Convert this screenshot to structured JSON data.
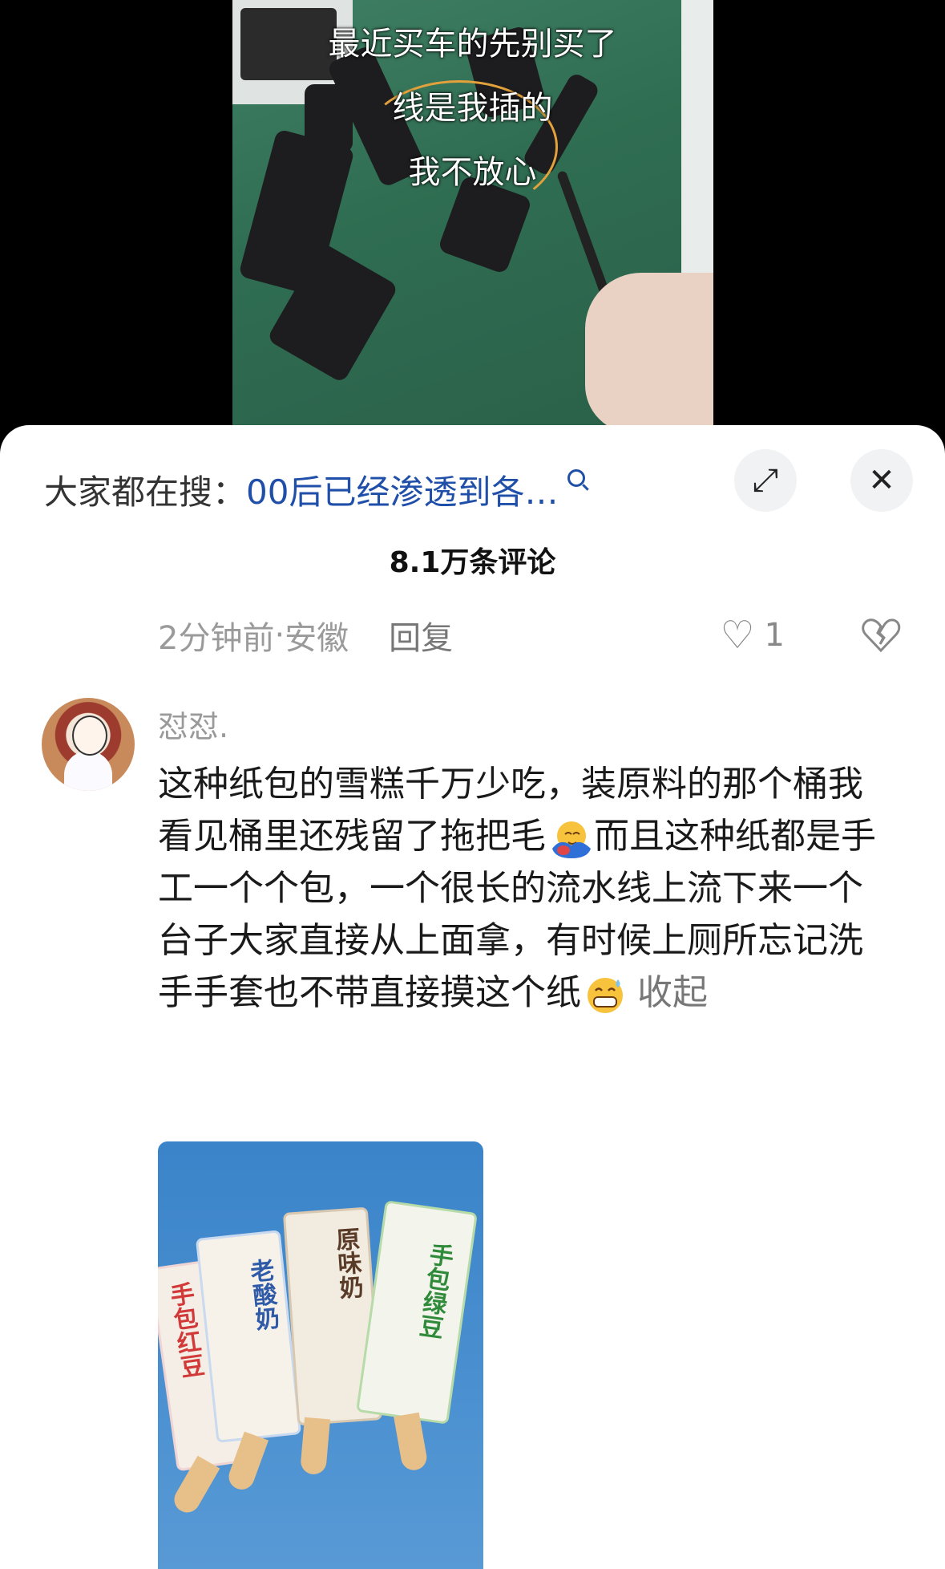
{
  "video": {
    "captions": [
      "最近买车的先别买了",
      "线是我插的",
      "我不放心"
    ]
  },
  "sheet": {
    "search_prefix": "大家都在搜：",
    "search_query": "00后已经渗透到各…",
    "expand_icon": "⤢",
    "close_icon": "✕",
    "comment_count": "8.1万条评论"
  },
  "prev_comment": {
    "time": "2分钟前",
    "separator": " · ",
    "location": "安徽",
    "reply": "回复",
    "likes": "1"
  },
  "comment": {
    "username": "怼怼.",
    "text_before_emoji1": "这种纸包的雪糕千万少吃，装原料的那个桶我看见桶里还残留了拖把毛",
    "text_after_emoji1": "而且这种纸都是手工一个个包，一个很长的流水线上流下来一个台子大家直接从上面拿，有时候上厕所忘记洗手手套也不带直接摸这个纸",
    "collapse": "收起",
    "emojis": [
      "hugging-face-emoji",
      "grinning-sweat-emoji"
    ],
    "image_labels": [
      "手包红豆",
      "老酸奶",
      "原味奶",
      "手包绿豆"
    ]
  }
}
